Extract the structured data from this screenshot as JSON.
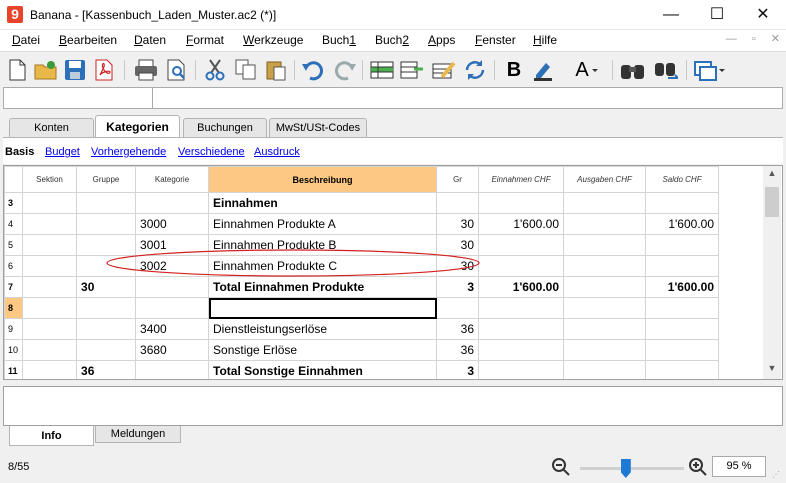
{
  "window": {
    "app_icon": "9",
    "title": "Banana - [Kassenbuch_Laden_Muster.ac2 (*)]",
    "minimize": "—",
    "maximize": "☐",
    "close": "✕"
  },
  "menu": [
    "Datei",
    "Bearbeiten",
    "Daten",
    "Format",
    "Werkzeuge",
    "Buch1",
    "Buch2",
    "Apps",
    "Fenster",
    "Hilfe"
  ],
  "menu_underline": [
    "D",
    "B",
    "D",
    "F",
    "W",
    "1",
    "2",
    "A",
    "F",
    "H"
  ],
  "mdi": {
    "minimize": "—",
    "restore": "▫",
    "close": "✕"
  },
  "toolbar": {
    "icons": [
      "new-document-icon",
      "open-folder-icon",
      "save-icon",
      "pdf-icon",
      "print-icon",
      "print-preview-icon",
      "cut-icon",
      "copy-icon",
      "paste-icon",
      "undo-icon",
      "redo-icon",
      "add-rows-icon",
      "insert-rows-icon",
      "edit-rows-icon",
      "recheck-icon",
      "bold-icon",
      "highlight-icon",
      "text-color-icon",
      "find-icon",
      "find-next-icon",
      "window-icon"
    ],
    "bold_label": "B",
    "text_color_label": "A"
  },
  "editor": {
    "left": "",
    "right": ""
  },
  "table_tabs": [
    "Konten",
    "Kategorien",
    "Buchungen",
    "MwSt/USt-Codes"
  ],
  "active_table_tab": "Kategorien",
  "views": [
    "Basis",
    "Budget",
    "Vorhergehende",
    "Verschiedene",
    "Ausdruck"
  ],
  "active_view": "Basis",
  "grid": {
    "columns": [
      "",
      "Sektion",
      "Gruppe",
      "Kategorie",
      "Beschreibung",
      "Gr",
      "Einnahmen CHF",
      "Ausgaben CHF",
      "Saldo CHF"
    ],
    "rows": [
      {
        "n": "3",
        "sektion": "",
        "gruppe": "",
        "kategorie": "",
        "beschreibung": "Einnahmen",
        "gr": "",
        "einnahmen": "",
        "ausgaben": "",
        "saldo": "",
        "bold": true
      },
      {
        "n": "4",
        "sektion": "",
        "gruppe": "",
        "kategorie": "3000",
        "beschreibung": "Einnahmen Produkte A",
        "gr": "30",
        "einnahmen": "1'600.00",
        "ausgaben": "",
        "saldo": "1'600.00",
        "bold": false
      },
      {
        "n": "5",
        "sektion": "",
        "gruppe": "",
        "kategorie": "3001",
        "beschreibung": "Einnahmen Produkte B",
        "gr": "30",
        "einnahmen": "",
        "ausgaben": "",
        "saldo": "",
        "bold": false
      },
      {
        "n": "6",
        "sektion": "",
        "gruppe": "",
        "kategorie": "3002",
        "beschreibung": "Einnahmen Produkte C",
        "gr": "30",
        "einnahmen": "",
        "ausgaben": "",
        "saldo": "",
        "bold": false
      },
      {
        "n": "7",
        "sektion": "",
        "gruppe": "30",
        "kategorie": "",
        "beschreibung": "Total Einnahmen Produkte",
        "gr": "3",
        "einnahmen": "1'600.00",
        "ausgaben": "",
        "saldo": "1'600.00",
        "bold": true
      },
      {
        "n": "8",
        "sektion": "",
        "gruppe": "",
        "kategorie": "",
        "beschreibung": "",
        "gr": "",
        "einnahmen": "",
        "ausgaben": "",
        "saldo": "",
        "bold": false,
        "selected": true
      },
      {
        "n": "9",
        "sektion": "",
        "gruppe": "",
        "kategorie": "3400",
        "beschreibung": "Dienstleistungserlöse",
        "gr": "36",
        "einnahmen": "",
        "ausgaben": "",
        "saldo": "",
        "bold": false
      },
      {
        "n": "10",
        "sektion": "",
        "gruppe": "",
        "kategorie": "3680",
        "beschreibung": "Sonstige Erlöse",
        "gr": "36",
        "einnahmen": "",
        "ausgaben": "",
        "saldo": "",
        "bold": false
      },
      {
        "n": "11",
        "sektion": "",
        "gruppe": "36",
        "kategorie": "",
        "beschreibung": "Total Sonstige Einnahmen",
        "gr": "3",
        "einnahmen": "",
        "ausgaben": "",
        "saldo": "",
        "bold": true
      }
    ],
    "highlight_color": "#fcc883",
    "annotation_color": "#d42020"
  },
  "bottom_tabs": [
    "Info",
    "Meldungen"
  ],
  "active_bottom_tab": "Info",
  "status": {
    "count": "8/55",
    "zoom_value": "95",
    "zoom_unit": "%",
    "zoom_slider_level": 0.45
  }
}
